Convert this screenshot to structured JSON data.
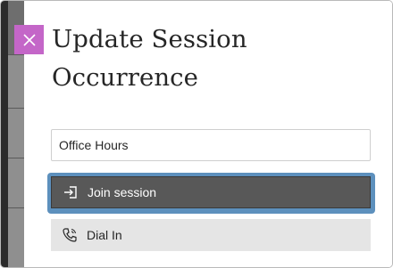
{
  "panel": {
    "title_line1": "Update Session",
    "title_line2": "Occurrence",
    "close_label": "Close"
  },
  "form": {
    "session_name_value": "Office Hours"
  },
  "buttons": {
    "join_label": "Join session",
    "dial_label": "Dial In"
  },
  "colors": {
    "close_bg": "#c466c8",
    "join_bg": "#585858",
    "focus_ring": "#5d90bd",
    "dial_bg": "#e5e5e5"
  },
  "icons": {
    "close": "close-icon",
    "join": "sign-in-icon",
    "dial": "phone-icon"
  }
}
